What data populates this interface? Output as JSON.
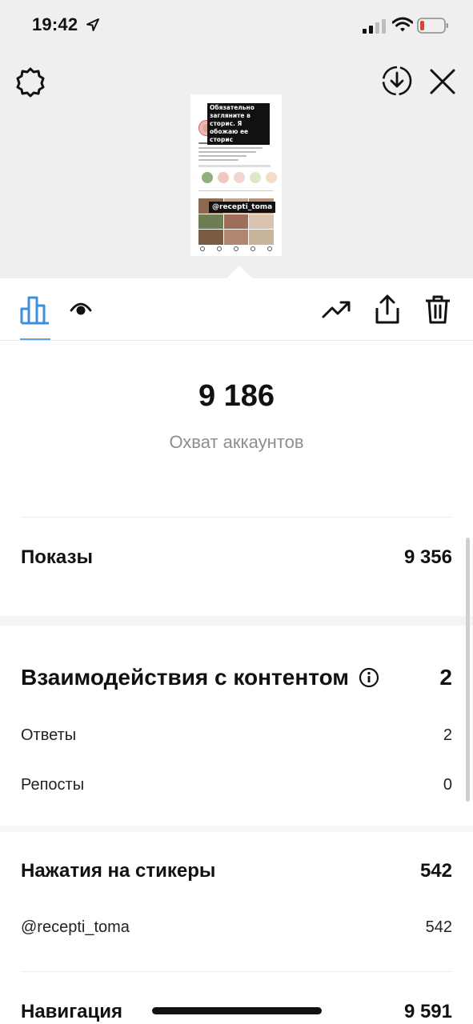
{
  "status_bar": {
    "time": "19:42",
    "icons": [
      "location-arrow-icon",
      "cellular-signal-icon",
      "wifi-icon",
      "battery-low-icon"
    ],
    "battery_color": "#e0413a"
  },
  "toolbar": {
    "icons": [
      "gear-icon",
      "download-icon",
      "close-icon"
    ]
  },
  "story_preview": {
    "sticker_text": "Обязательно загляните в сторис. Я обожаю ее сторис",
    "mention_sticker": "@recepti_toma"
  },
  "tabs": {
    "items": [
      "insights-icon",
      "viewers-icon",
      "promote-icon",
      "share-icon",
      "delete-icon"
    ],
    "active": "insights-icon",
    "accent_color": "#3d8fe0"
  },
  "reach": {
    "value": "9 186",
    "label": "Охват аккаунтов"
  },
  "impressions": {
    "label": "Показы",
    "value": "9 356"
  },
  "interactions": {
    "label": "Взаимодействия с контентом",
    "value": "2",
    "items": [
      {
        "label": "Ответы",
        "value": "2"
      },
      {
        "label": "Репосты",
        "value": "0"
      }
    ]
  },
  "sticker_taps": {
    "label": "Нажатия на стикеры",
    "value": "542",
    "items": [
      {
        "label": "@recepti_toma",
        "value": "542"
      }
    ]
  },
  "navigation": {
    "label": "Навигация",
    "value": "9 591"
  }
}
